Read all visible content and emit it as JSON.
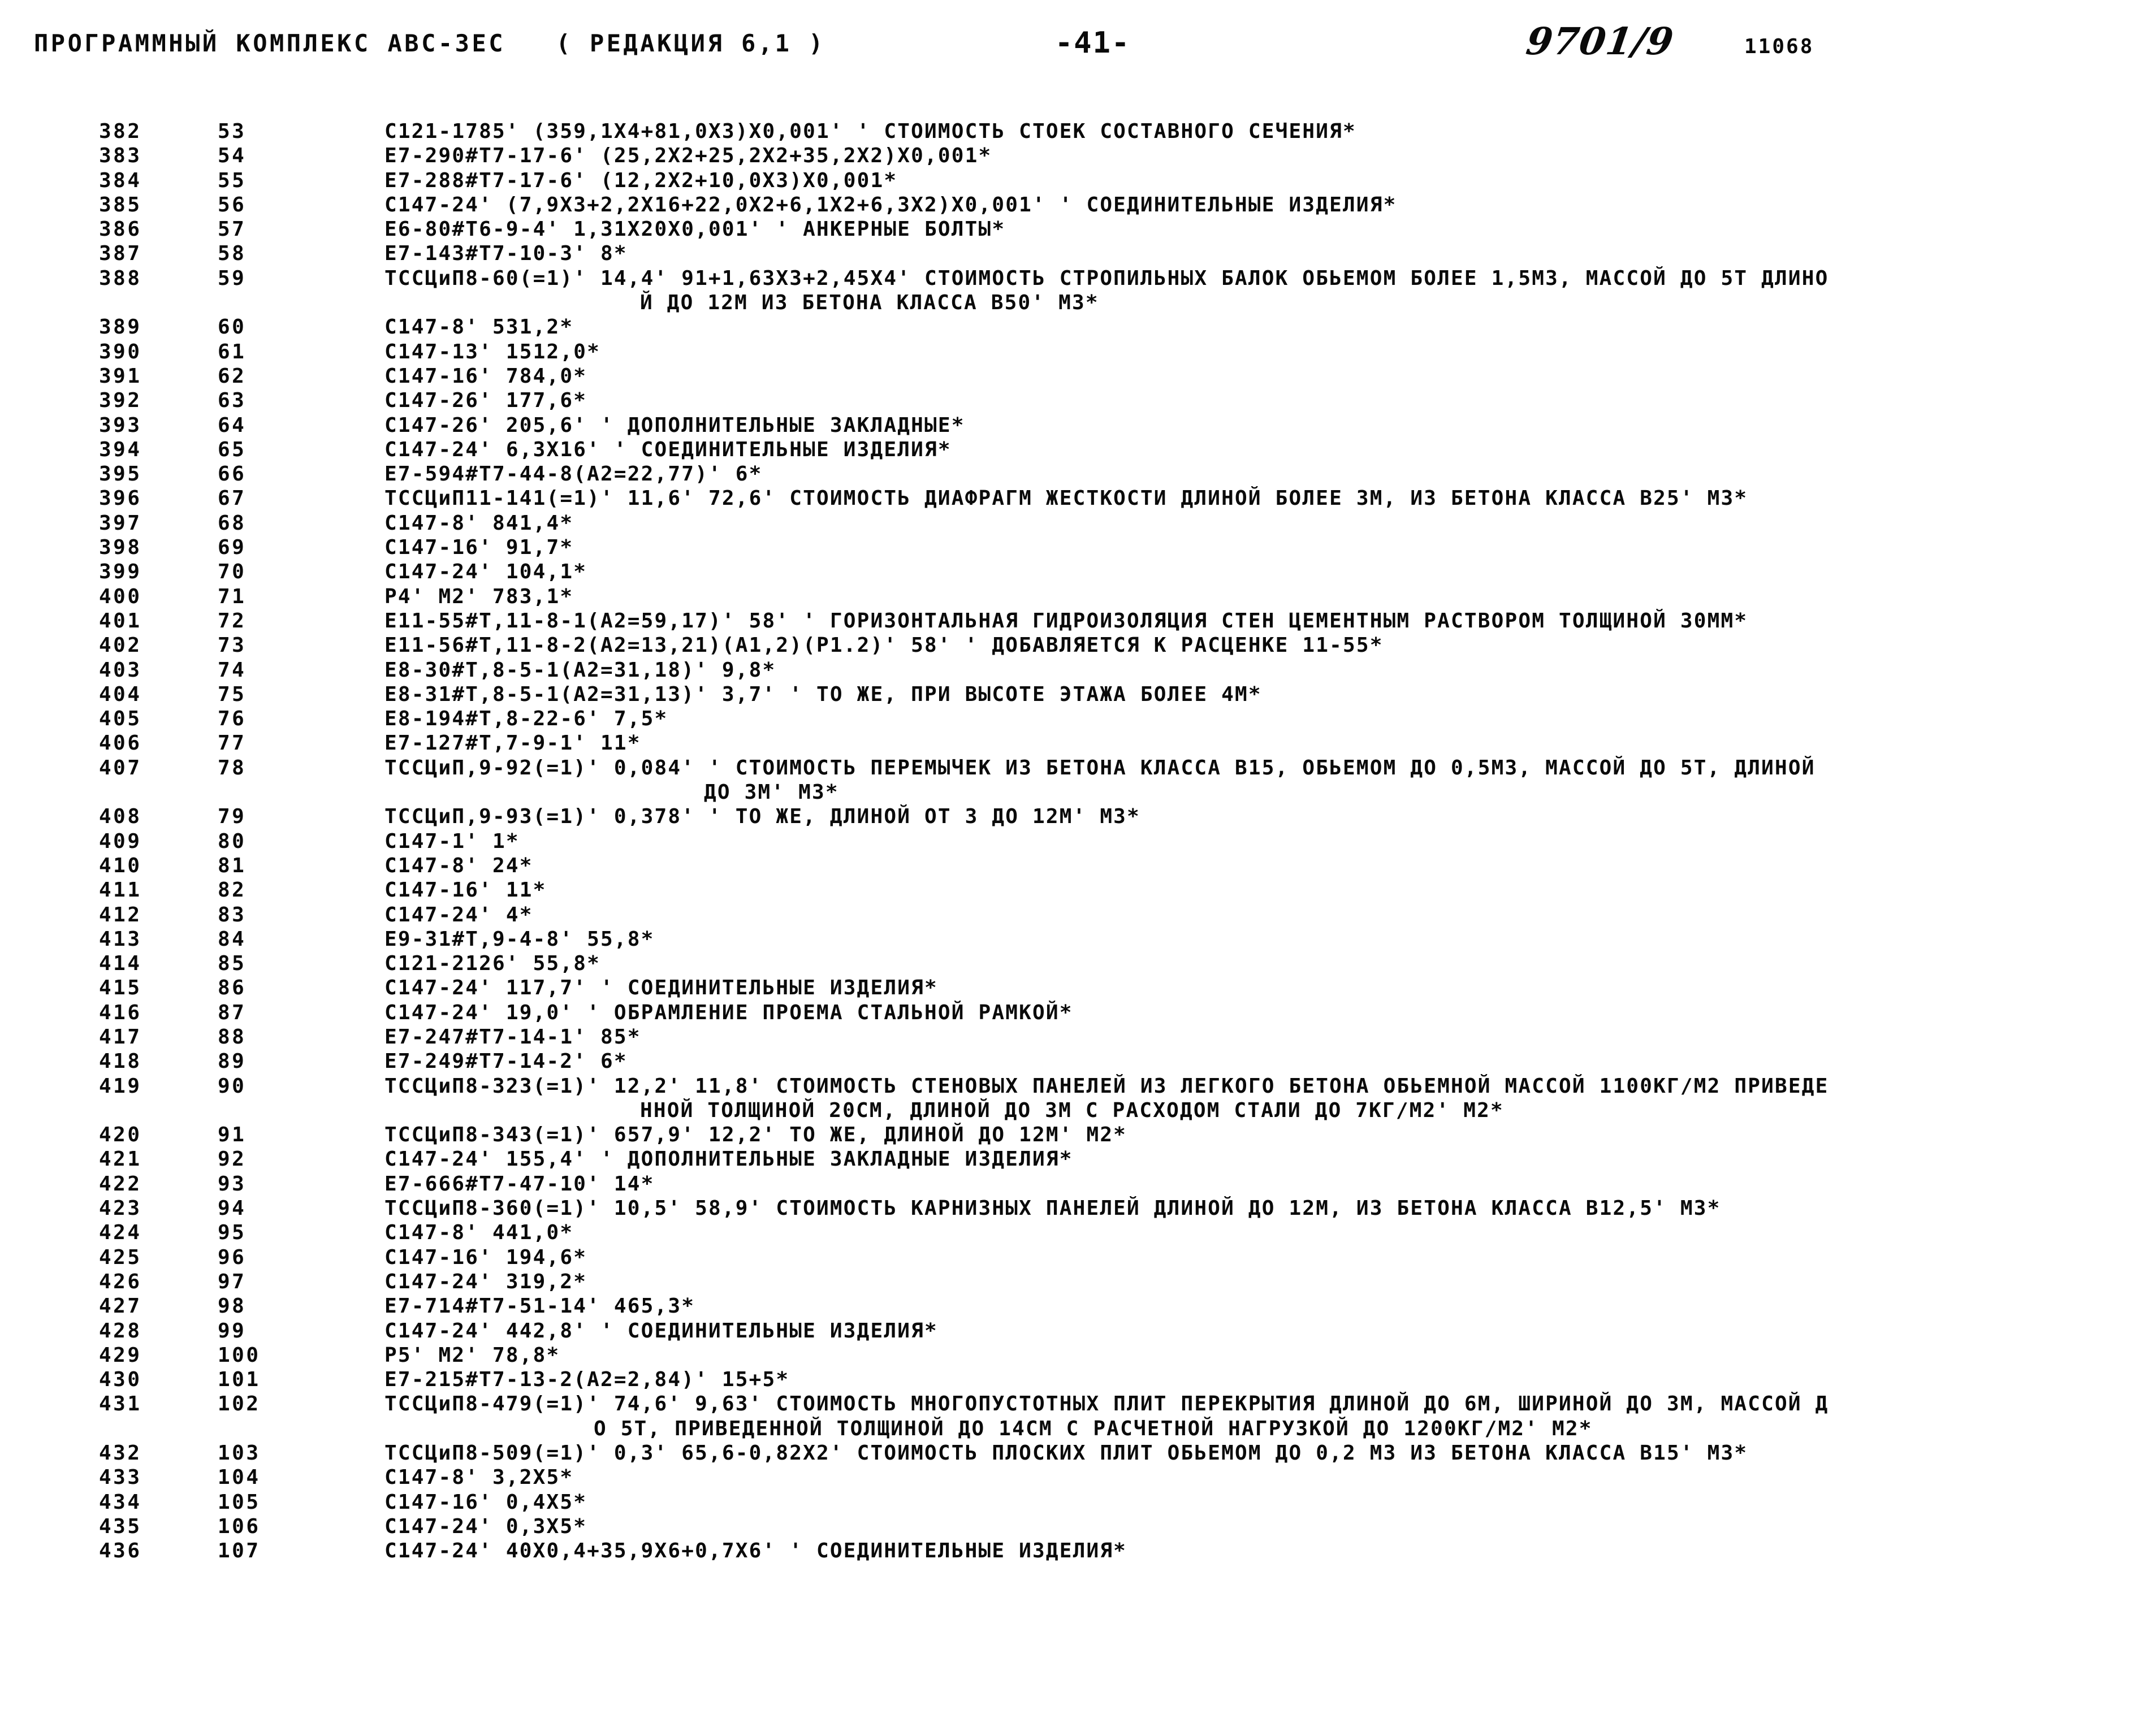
{
  "header": {
    "title": "ПРОГРАММНЫЙ КОМПЛЕКС АВС-ЗЕС   ( РЕДАКЦИЯ 6,1 )",
    "page_number": "-41-",
    "handwritten_note": "9701/9",
    "stamp_number": "11068"
  },
  "listing": {
    "columns": [
      "line_number",
      "sequence_number",
      "code"
    ],
    "rows": [
      {
        "n": "382",
        "s": "53",
        "c": "C121-1785' (359,1X4+81,0X3)X0,001' ' СТОИМОСТЬ СТОЕК СОСТАВНОГО СЕЧЕНИЯ*"
      },
      {
        "n": "383",
        "s": "54",
        "c": "E7-290#Т7-17-6' (25,2X2+25,2X2+35,2X2)X0,001*"
      },
      {
        "n": "384",
        "s": "55",
        "c": "E7-288#Т7-17-6' (12,2X2+10,0X3)X0,001*"
      },
      {
        "n": "385",
        "s": "56",
        "c": "C147-24' (7,9X3+2,2X16+22,0X2+6,1X2+6,3X2)X0,001' ' СОЕДИНИТЕЛЬНЫЕ ИЗДЕЛИЯ*"
      },
      {
        "n": "386",
        "s": "57",
        "c": "E6-80#Т6-9-4' 1,31X20X0,001' ' АНКЕРНЫЕ БОЛТЫ*"
      },
      {
        "n": "387",
        "s": "58",
        "c": "E7-143#Т7-10-3' 8*"
      },
      {
        "n": "388",
        "s": "59",
        "c": "ТССЦиП8-60(=1)' 14,4' 91+1,63X3+2,45X4' СТОИМОСТЬ СТРОПИЛЬНЫХ БАЛОК ОБЬЕМОМ БОЛЕЕ 1,5М3, МАССОЙ ДО 5Т ДЛИНО"
      },
      {
        "n": "",
        "s": "",
        "c": "Й ДО 12М ИЗ БЕТОНА КЛАССА В50' М3*",
        "indent": "indent-a"
      },
      {
        "n": "389",
        "s": "60",
        "c": "C147-8' 531,2*"
      },
      {
        "n": "390",
        "s": "61",
        "c": "C147-13' 1512,0*"
      },
      {
        "n": "391",
        "s": "62",
        "c": "C147-16' 784,0*"
      },
      {
        "n": "392",
        "s": "63",
        "c": "C147-26' 177,6*"
      },
      {
        "n": "393",
        "s": "64",
        "c": "C147-26' 205,6' ' ДОПОЛНИТЕЛЬНЫЕ ЗАКЛАДНЫЕ*"
      },
      {
        "n": "394",
        "s": "65",
        "c": "C147-24' 6,3X16' ' СОЕДИНИТЕЛЬНЫЕ ИЗДЕЛИЯ*"
      },
      {
        "n": "395",
        "s": "66",
        "c": "E7-594#Т7-44-8(А2=22,77)' 6*"
      },
      {
        "n": "396",
        "s": "67",
        "c": "ТССЦиП11-141(=1)' 11,6' 72,6' СТОИМОСТЬ ДИАФРАГМ ЖЕСТКОСТИ ДЛИНОЙ БОЛЕЕ 3М, ИЗ БЕТОНА КЛАССА В25' М3*"
      },
      {
        "n": "397",
        "s": "68",
        "c": "C147-8' 841,4*"
      },
      {
        "n": "398",
        "s": "69",
        "c": "C147-16' 91,7*"
      },
      {
        "n": "399",
        "s": "70",
        "c": "C147-24' 104,1*"
      },
      {
        "n": "400",
        "s": "71",
        "c": "P4' М2' 783,1*"
      },
      {
        "n": "401",
        "s": "72",
        "c": "E11-55#Т,11-8-1(А2=59,17)' 58' ' ГОРИЗОНТАЛЬНАЯ ГИДРОИЗОЛЯЦИЯ СТЕН ЦЕМЕНТНЫМ РАСТВОРОМ ТОЛЩИНОЙ 30ММ*"
      },
      {
        "n": "402",
        "s": "73",
        "c": "E11-56#Т,11-8-2(А2=13,21)(А1,2)(Р1.2)' 58' ' ДОБАВЛЯЕТСЯ К РАСЦЕНКЕ 11-55*"
      },
      {
        "n": "403",
        "s": "74",
        "c": "E8-30#Т,8-5-1(А2=31,18)' 9,8*"
      },
      {
        "n": "404",
        "s": "75",
        "c": "E8-31#Т,8-5-1(А2=31,13)' 3,7' ' ТО ЖЕ, ПРИ ВЫСОТЕ ЭТАЖА БОЛЕЕ 4М*"
      },
      {
        "n": "405",
        "s": "76",
        "c": "E8-194#Т,8-22-6' 7,5*"
      },
      {
        "n": "406",
        "s": "77",
        "c": "E7-127#Т,7-9-1' 11*"
      },
      {
        "n": "407",
        "s": "78",
        "c": "ТССЦиП,9-92(=1)' 0,084' ' СТОИМОСТЬ ПЕРЕМЫЧЕК ИЗ БЕТОНА КЛАССА В15, ОБЬЕМОМ ДО 0,5М3, МАССОЙ ДО 5Т, ДЛИНОЙ"
      },
      {
        "n": "",
        "s": "",
        "c": "ДО 3М' М3*",
        "indent": "indent-b"
      },
      {
        "n": "408",
        "s": "79",
        "c": "ТССЦиП,9-93(=1)' 0,378' ' ТО ЖЕ, ДЛИНОЙ ОТ 3 ДО 12М' М3*"
      },
      {
        "n": "409",
        "s": "80",
        "c": "C147-1' 1*"
      },
      {
        "n": "410",
        "s": "81",
        "c": "C147-8' 24*"
      },
      {
        "n": "411",
        "s": "82",
        "c": "C147-16' 11*"
      },
      {
        "n": "412",
        "s": "83",
        "c": "C147-24' 4*"
      },
      {
        "n": "413",
        "s": "84",
        "c": "E9-31#Т,9-4-8' 55,8*"
      },
      {
        "n": "414",
        "s": "85",
        "c": "C121-2126' 55,8*"
      },
      {
        "n": "415",
        "s": "86",
        "c": "C147-24' 117,7' ' СОЕДИНИТЕЛЬНЫЕ ИЗДЕЛИЯ*"
      },
      {
        "n": "416",
        "s": "87",
        "c": "C147-24' 19,0' ' ОБРАМЛЕНИЕ ПРОЕМА СТАЛЬНОЙ РАМКОЙ*"
      },
      {
        "n": "417",
        "s": "88",
        "c": "E7-247#Т7-14-1' 85*"
      },
      {
        "n": "418",
        "s": "89",
        "c": "E7-249#Т7-14-2' 6*"
      },
      {
        "n": "419",
        "s": "90",
        "c": "ТССЦиП8-323(=1)' 12,2' 11,8' СТОИМОСТЬ СТЕНОВЫХ ПАНЕЛЕЙ ИЗ ЛЕГКОГО БЕТОНА ОБЬЕМНОЙ МАССОЙ 1100КГ/М2 ПРИВЕДЕ"
      },
      {
        "n": "",
        "s": "",
        "c": "ННОЙ ТОЛЩИНОЙ 20СМ, ДЛИНОЙ ДО 3М С РАСХОДОМ СТАЛИ ДО 7КГ/М2' М2*",
        "indent": "indent-a"
      },
      {
        "n": "420",
        "s": "91",
        "c": "ТССЦиП8-343(=1)' 657,9' 12,2' ТО ЖЕ, ДЛИНОЙ ДО 12М' М2*"
      },
      {
        "n": "421",
        "s": "92",
        "c": "C147-24' 155,4' ' ДОПОЛНИТЕЛЬНЫЕ ЗАКЛАДНЫЕ ИЗДЕЛИЯ*"
      },
      {
        "n": "422",
        "s": "93",
        "c": "E7-666#Т7-47-10' 14*"
      },
      {
        "n": "423",
        "s": "94",
        "c": "ТССЦиП8-360(=1)' 10,5' 58,9' СТОИМОСТЬ КАРНИЗНЫХ ПАНЕЛЕЙ ДЛИНОЙ ДО 12М, ИЗ БЕТОНА КЛАССА В12,5' М3*"
      },
      {
        "n": "424",
        "s": "95",
        "c": "C147-8' 441,0*"
      },
      {
        "n": "425",
        "s": "96",
        "c": "C147-16' 194,6*"
      },
      {
        "n": "426",
        "s": "97",
        "c": "C147-24' 319,2*"
      },
      {
        "n": "427",
        "s": "98",
        "c": "E7-714#Т7-51-14' 465,3*"
      },
      {
        "n": "428",
        "s": "99",
        "c": "C147-24' 442,8' ' СОЕДИНИТЕЛЬНЫЕ ИЗДЕЛИЯ*"
      },
      {
        "n": "429",
        "s": "100",
        "c": "P5' М2' 78,8*"
      },
      {
        "n": "430",
        "s": "101",
        "c": "E7-215#Т7-13-2(А2=2,84)' 15+5*"
      },
      {
        "n": "431",
        "s": "102",
        "c": "ТССЦиП8-479(=1)' 74,6' 9,63' СТОИМОСТЬ МНОГОПУСТОТНЫХ ПЛИТ ПЕРЕКРЫТИЯ ДЛИНОЙ ДО 6М, ШИРИНОЙ ДО 3М, МАССОЙ Д"
      },
      {
        "n": "",
        "s": "",
        "c": "О 5Т, ПРИВЕДЕННОЙ ТОЛЩИНОЙ ДО 14СМ С РАСЧЕТНОЙ НАГРУЗКОЙ ДО 1200КГ/М2' М2*",
        "indent": "indent-c"
      },
      {
        "n": "432",
        "s": "103",
        "c": "ТССЦиП8-509(=1)' 0,3' 65,6-0,82X2' СТОИМОСТЬ ПЛОСКИХ ПЛИТ ОБЬЕМОМ ДО 0,2 М3 ИЗ БЕТОНА КЛАССА В15' М3*"
      },
      {
        "n": "433",
        "s": "104",
        "c": "C147-8' 3,2X5*"
      },
      {
        "n": "434",
        "s": "105",
        "c": "C147-16' 0,4X5*"
      },
      {
        "n": "435",
        "s": "106",
        "c": "C147-24' 0,3X5*"
      },
      {
        "n": "436",
        "s": "107",
        "c": "C147-24' 40X0,4+35,9X6+0,7X6' ' СОЕДИНИТЕЛЬНЫЕ ИЗДЕЛИЯ*"
      }
    ]
  }
}
